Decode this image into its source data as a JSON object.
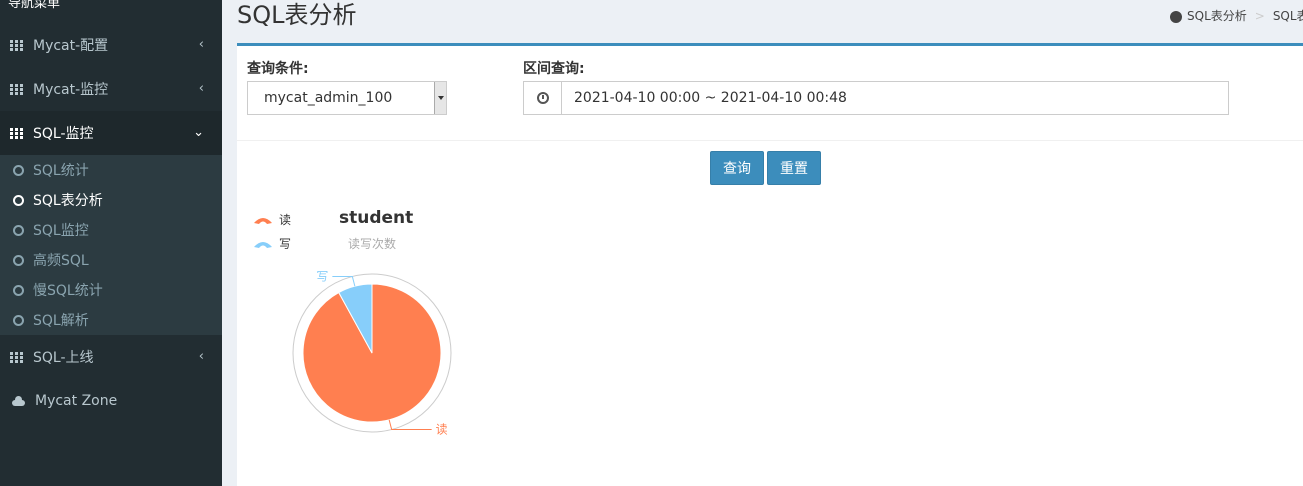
{
  "sidebar": {
    "header_cut": "导航菜单",
    "items": [
      {
        "label": "Mycat-配置",
        "chevron": "‹"
      },
      {
        "label": "Mycat-监控",
        "chevron": "‹"
      },
      {
        "label": "SQL-监控",
        "chevron": "⌄"
      },
      {
        "label": "SQL-上线",
        "chevron": "‹"
      },
      {
        "label": "Mycat Zone"
      }
    ],
    "sub_items": [
      "SQL统计",
      "SQL表分析",
      "SQL监控",
      "高频SQL",
      "慢SQL统计",
      "SQL解析"
    ]
  },
  "page": {
    "title": "SQL表分析",
    "breadcrumb": [
      "SQL表分析",
      "SQL表"
    ]
  },
  "form": {
    "query_label": "查询条件:",
    "query_value": "mycat_admin_100",
    "range_label": "区间查询:",
    "range_value": "2021-04-10 00:00 ~ 2021-04-10 00:48",
    "search_button": "查询",
    "reset_button": "重置"
  },
  "colors": {
    "read": "#ff7f50",
    "write": "#87cefa",
    "accent": "#3c8dbc"
  },
  "chart_data": {
    "type": "pie",
    "title": "student",
    "subtitle": "读写次数",
    "legend": [
      "读",
      "写"
    ],
    "legend_placement": "top-left",
    "slices": [
      {
        "name": "读",
        "value": 92
      },
      {
        "name": "写",
        "value": 8
      }
    ]
  }
}
